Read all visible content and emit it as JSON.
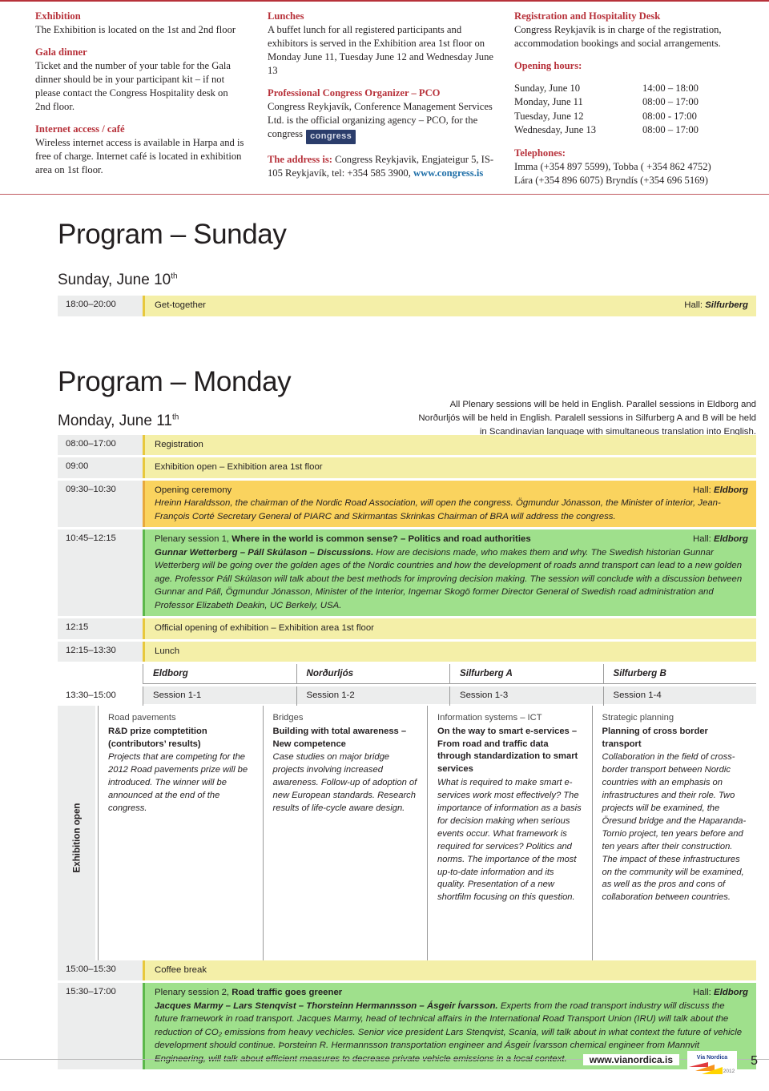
{
  "info": {
    "col1": [
      {
        "heading": "Exhibition",
        "text": "The Exhibition is located on the 1st and 2nd floor"
      },
      {
        "heading": "Gala dinner",
        "text": "Ticket and the number of your table for the Gala dinner should be in your participant kit – if not please contact the Congress Hospitality desk on 2nd floor."
      },
      {
        "heading": "Internet access / café",
        "text": "Wireless internet access is available in Harpa and is free of charge. Internet café is located in exhibition area on 1st floor."
      }
    ],
    "col2": {
      "lunches_heading": "Lunches",
      "lunches_text": "A buffet lunch for all registered participants and exhibitors is served in the Exhibition area 1st floor on Monday June 11, Tuesday June 12 and Wednesday June 13",
      "pco_heading": "Professional Congress Organizer – PCO",
      "pco_text_a": "Congress Reykjavík, Conference Management Services Ltd. is the official organizing agency – PCO, for the congress",
      "pco_logo_label": "congress",
      "address_label": "The address is:",
      "address_text": " Congress Reykjavik, Engjateigur 5, IS-105 Reykjavík, tel: +354 585 3900, ",
      "address_link": "www.congress.is"
    },
    "col3": {
      "desk_heading": "Registration and Hospitality Desk",
      "desk_text": "Congress Reykjavík is in charge of the registration, accommodation bookings and social arrangements.",
      "hours_heading": "Opening hours:",
      "hours": [
        {
          "day": "Sunday, June 10",
          "time": "14:00 – 18:00"
        },
        {
          "day": "Monday, June 11",
          "time": "08:00 – 17:00"
        },
        {
          "day": "Tuesday, June 12",
          "time": "08:00 -  17:00"
        },
        {
          "day": "Wednesday, June 13",
          "time": "08:00 – 17:00"
        }
      ],
      "phones_heading": "Telephones:",
      "phones_line1": "Imma  (+354 897 5599), Tobba ( +354 862 4752)",
      "phones_line2": "Lára   (+354 896 6075) Bryndís (+354 696 5169)"
    }
  },
  "sunday": {
    "title": "Program – Sunday",
    "day": "Sunday, June 10",
    "day_sup": "th",
    "row": {
      "time": "18:00–20:00",
      "label": "Get-together",
      "hall_label": "Hall: ",
      "hall": "Silfurberg"
    }
  },
  "monday": {
    "title": "Program – Monday",
    "day": "Monday, June 11",
    "day_sup": "th",
    "note": "All Plenary sessions will be held in English. Parallel sessions in Eldborg and Norðurljós will be held in English. Paralell sessions in Silfurberg A and B will be held in Scandinavian language with simultaneous translation into English.",
    "rows": [
      {
        "time": "08:00–17:00",
        "label": "Registration"
      },
      {
        "time": "09:00",
        "label": "Exhibition open – Exhibition area 1st floor"
      },
      {
        "time": "09:30–10:30",
        "label": "Opening ceremony",
        "hall_label": "Hall: ",
        "hall": "Eldborg",
        "desc": "Hreinn Haraldsson, the chairman of the Nordic Road Association, will open the congress. Ögmundur Jónasson, the Minister of interior, Jean-François Corté Secretary General of PIARC and Skirmantas Skrinkas Chairman of BRA will address the congress."
      },
      {
        "time": "10:45–12:15",
        "label_plain": "Plenary session 1, ",
        "label_bold": "Where in the world is common sense? – Politics and road authorities",
        "hall_label": "Hall: ",
        "hall": "Eldborg",
        "lead": "Gunnar Wetterberg – Páll Skúlason – Discussions.",
        "desc": " How are decisions made, who makes them and why. The Swedish historian Gunnar Wetterberg will be going over the golden ages of the Nordic countries and how the development of roads annd transport can lead to a new golden age. Professor Páll Skúlason will talk about the best methods for improving decision making. The session will conclude with a discussion between Gunnar and Páll, Ögmundur Jónasson, Minister of the Interior, Ingemar Skogö former Director General of Swedish road administration and Professor Elizabeth Deakin, UC Berkely, USA."
      },
      {
        "time": "12:15",
        "label": "Official opening of exhibition – Exhibition area 1st floor"
      },
      {
        "time": "12:15–13:30",
        "label": "Lunch"
      }
    ],
    "exhibition_vertical": "Exhibition open",
    "parallel_time": "13:30–15:00",
    "halls": [
      "Eldborg",
      "Norðurljós",
      "Silfurberg A",
      "Silfurberg B"
    ],
    "sessions": [
      {
        "code": "Session 1-1",
        "topic": "Road pavements",
        "title": "R&D prize comptetition (contributors’ results)",
        "text": "Projects that are competing for the 2012 Road pavements prize will be introduced. The winner will be announced at the end of the congress."
      },
      {
        "code": "Session 1-2",
        "topic": "Bridges",
        "title": "Building with total awareness – New competence",
        "text": "Case studies on major bridge projects involving increased awareness. Follow-up of adoption of new European standards. Research results of life-cycle aware design."
      },
      {
        "code": "Session 1-3",
        "topic": "Information systems – ICT",
        "title": "On the way to smart e-services – From road and traffic data through standardization to smart services",
        "text": "What is required to make smart e-services work most effectively? The importance of information as a basis for decision making when serious events occur. What framework is required for services? Politics and norms. The importance of the most up-to-date information and its quality. Presentation of a new shortfilm focusing on this question."
      },
      {
        "code": "Session 1-4",
        "topic": "Strategic planning",
        "title": "Planning of cross border transport",
        "text": "Collaboration in the field of cross-border transport between Nordic countries with an emphasis on infrastructures and their role. Two projects will be examined, the Öresund bridge and the Haparanda-Tornio project, ten years before and ten years after their construction. The impact of these infrastructures on the community will be examined, as well as the pros and cons of collaboration between countries."
      }
    ],
    "tail_rows": [
      {
        "time": "15:00–15:30",
        "label": "Coffee break"
      },
      {
        "time": "15:30–17:00",
        "label_plain": "Plenary session 2, ",
        "label_bold": "Road traffic goes greener",
        "hall_label": "Hall: ",
        "hall": "Eldborg",
        "lead": "Jacques Marmy – Lars Stenqvist – Thorsteinn Hermannsson – Ásgeir Ívarsson.",
        "desc": " Experts from the road transport industry will discuss the future framework in road transport. Jacques Marmy, head of technical affairs in the International Road Transport Union (IRU) will talk about the reduction of CO₂ emissions from heavy vechicles. Senior vice president Lars Stenqvist, Scania, will talk about in what context the future of vehicle development should continue. Þorsteinn R. Hermannsson transportation engineer and Ásgeir Ívarsson chemical engineer from Mannvit Engineering, will talk about efficient measures to decrease private vehicle emissions in a local context."
      }
    ]
  },
  "footer": {
    "url": "www.vianordica.is",
    "page": "5",
    "logo_text": "Via Nordica",
    "logo_year": "2012"
  },
  "colors": {
    "accent_red": "#b7313a",
    "pale_yellow": "#f4efa8",
    "gold": "#fad35e",
    "green": "#9fe08c",
    "grey": "#eceded",
    "link_blue": "#1f6fa8"
  }
}
